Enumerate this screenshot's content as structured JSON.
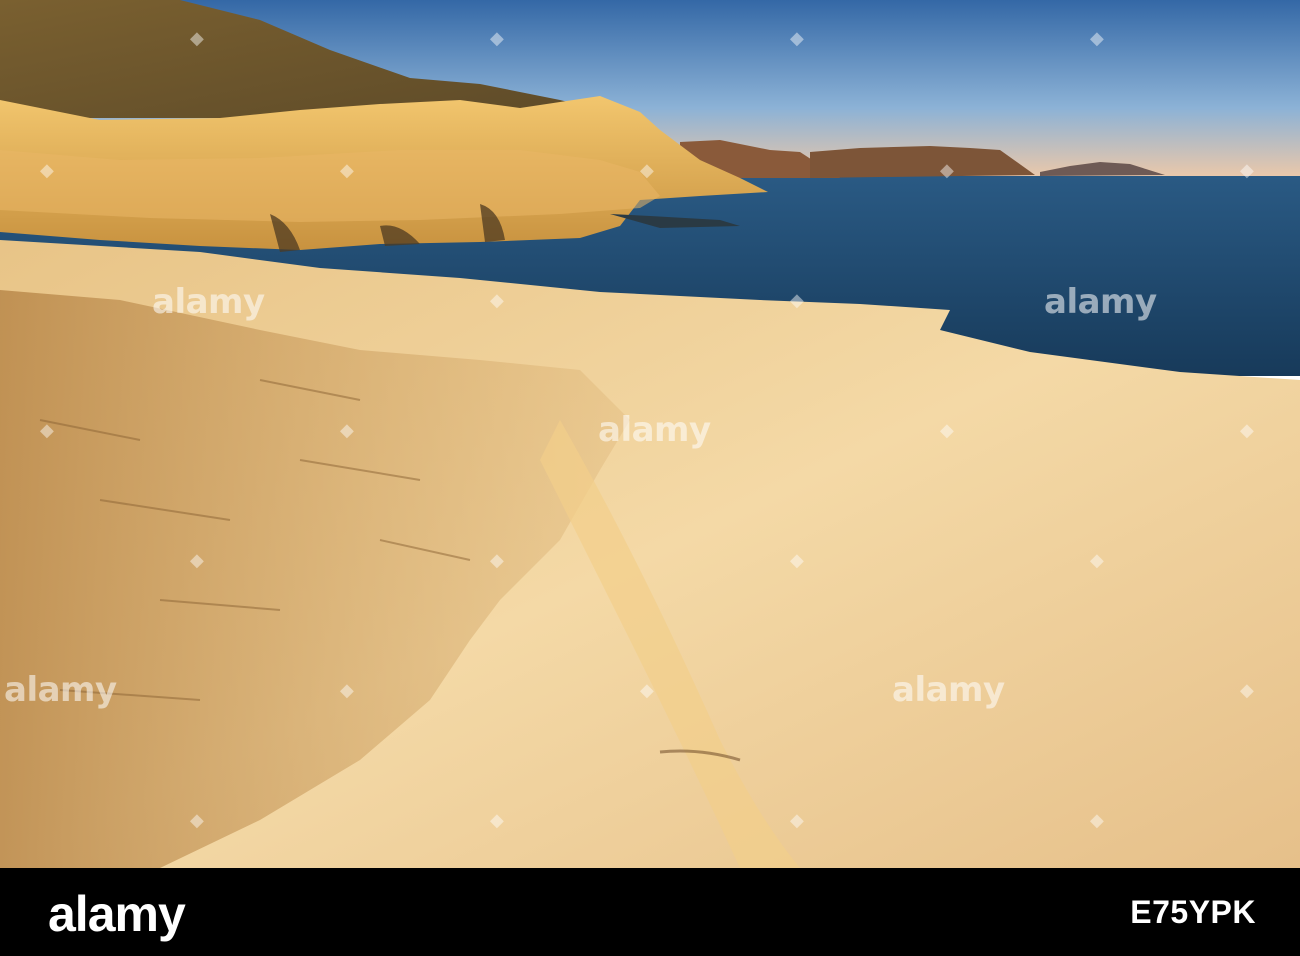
{
  "watermark": {
    "text": "alamy",
    "icon": "alamy-logo-icon"
  },
  "footer": {
    "brand": "alamy",
    "image_ref": "E75YPK"
  },
  "colors": {
    "sky_top": "#3b6fa8",
    "sky_horizon": "#e9c9a6",
    "sea": "#1f4a6e",
    "rock_light": "#f0d19a",
    "rock_shadow": "#b98a4c",
    "footer_bg": "#000000"
  }
}
